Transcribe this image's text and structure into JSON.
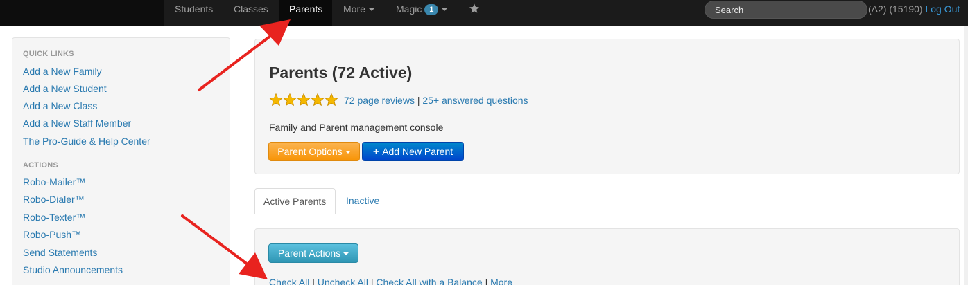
{
  "navbar": {
    "items": [
      {
        "label": "Students",
        "active": false
      },
      {
        "label": "Classes",
        "active": false
      },
      {
        "label": "Parents",
        "active": true
      },
      {
        "label": "More",
        "active": false
      },
      {
        "label": "Magic",
        "active": false
      }
    ],
    "magic_badge": "1",
    "star_icon": "star-icon",
    "search_placeholder": "Search",
    "account_text": "(A2) (15190)",
    "logout_label": "Log Out"
  },
  "sidebar": {
    "quick_links_header": "QUICK LINKS",
    "quick_links": [
      "Add a New Family",
      "Add a New Student",
      "Add a New Class",
      "Add a New Staff Member",
      "The Pro-Guide & Help Center"
    ],
    "actions_header": "ACTIONS",
    "actions": [
      "Robo-Mailer™",
      "Robo-Dialer™",
      "Robo-Texter™",
      "Robo-Push™",
      "Send Statements",
      "Studio Announcements"
    ]
  },
  "hero": {
    "title": "Parents (72 Active)",
    "rating_stars": 5,
    "reviews_link": "72 page reviews",
    "separator": "|",
    "questions_link": "25+ answered questions",
    "description": "Family and Parent management console",
    "parent_options_label": "Parent Options",
    "add_parent_label": "Add New Parent"
  },
  "tabs": {
    "active_label": "Active Parents",
    "inactive_label": "Inactive"
  },
  "well": {
    "parent_actions_label": "Parent Actions",
    "check_all": "Check All",
    "uncheck_all": "Uncheck All",
    "check_balance": "Check All with a Balance",
    "more": "More",
    "sep": "|"
  },
  "colors": {
    "navbar_bg": "#1b1b1b",
    "link": "#2a7ab0",
    "orange_button": "#f89406",
    "blue_button": "#0044cc",
    "teal_button": "#2f96b4",
    "annotation_arrow": "#e8231f"
  }
}
